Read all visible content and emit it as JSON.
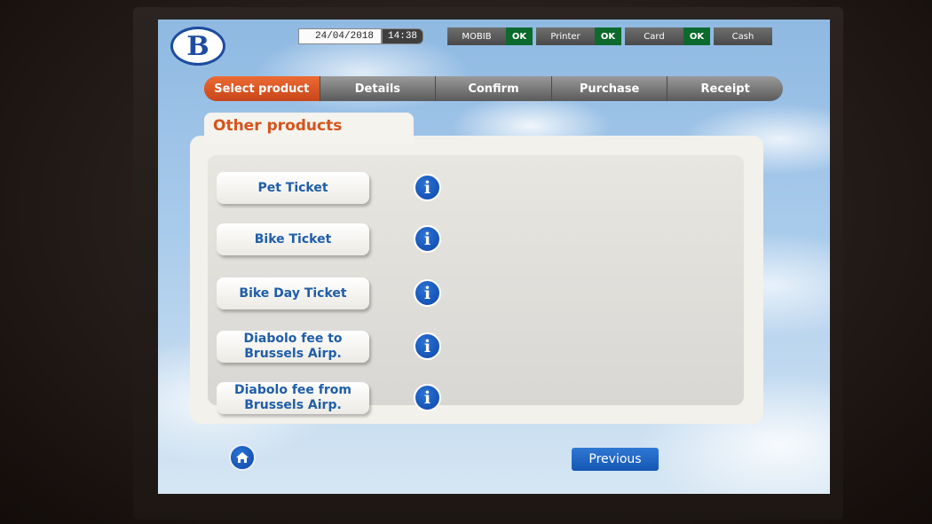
{
  "header": {
    "logo_letter": "B",
    "date": "24/04/2018",
    "time": "14:38"
  },
  "status": [
    {
      "label": "MOBIB",
      "value": "OK",
      "value_color": "#0c6a2c"
    },
    {
      "label": "Printer",
      "value": "OK",
      "value_color": "#0c6a2c"
    },
    {
      "label": "Card",
      "value": "OK",
      "value_color": "#0c6a2c"
    },
    {
      "label": "Cash",
      "value": ""
    }
  ],
  "steps": [
    {
      "label": "Select product",
      "active": true
    },
    {
      "label": "Details",
      "active": false
    },
    {
      "label": "Confirm",
      "active": false
    },
    {
      "label": "Purchase",
      "active": false
    },
    {
      "label": "Receipt",
      "active": false
    }
  ],
  "main": {
    "title": "Other products",
    "products": [
      {
        "label": "Pet Ticket",
        "info_icon": "info-icon"
      },
      {
        "label": "Bike Ticket",
        "info_icon": "info-icon"
      },
      {
        "label": "Bike Day Ticket",
        "info_icon": "info-icon"
      },
      {
        "label": "Diabolo fee to Brussels Airp.",
        "info_icon": "info-icon"
      },
      {
        "label": "Diabolo fee from Brussels Airp.",
        "info_icon": "info-icon"
      }
    ],
    "info_glyph": "i"
  },
  "footer": {
    "home_icon": "home-icon",
    "previous_label": "Previous"
  },
  "colors": {
    "accent": "#d5541c",
    "brand_blue": "#1c4c9f",
    "button_blue": "#1557b4",
    "ok_green": "#0c6a2c"
  }
}
